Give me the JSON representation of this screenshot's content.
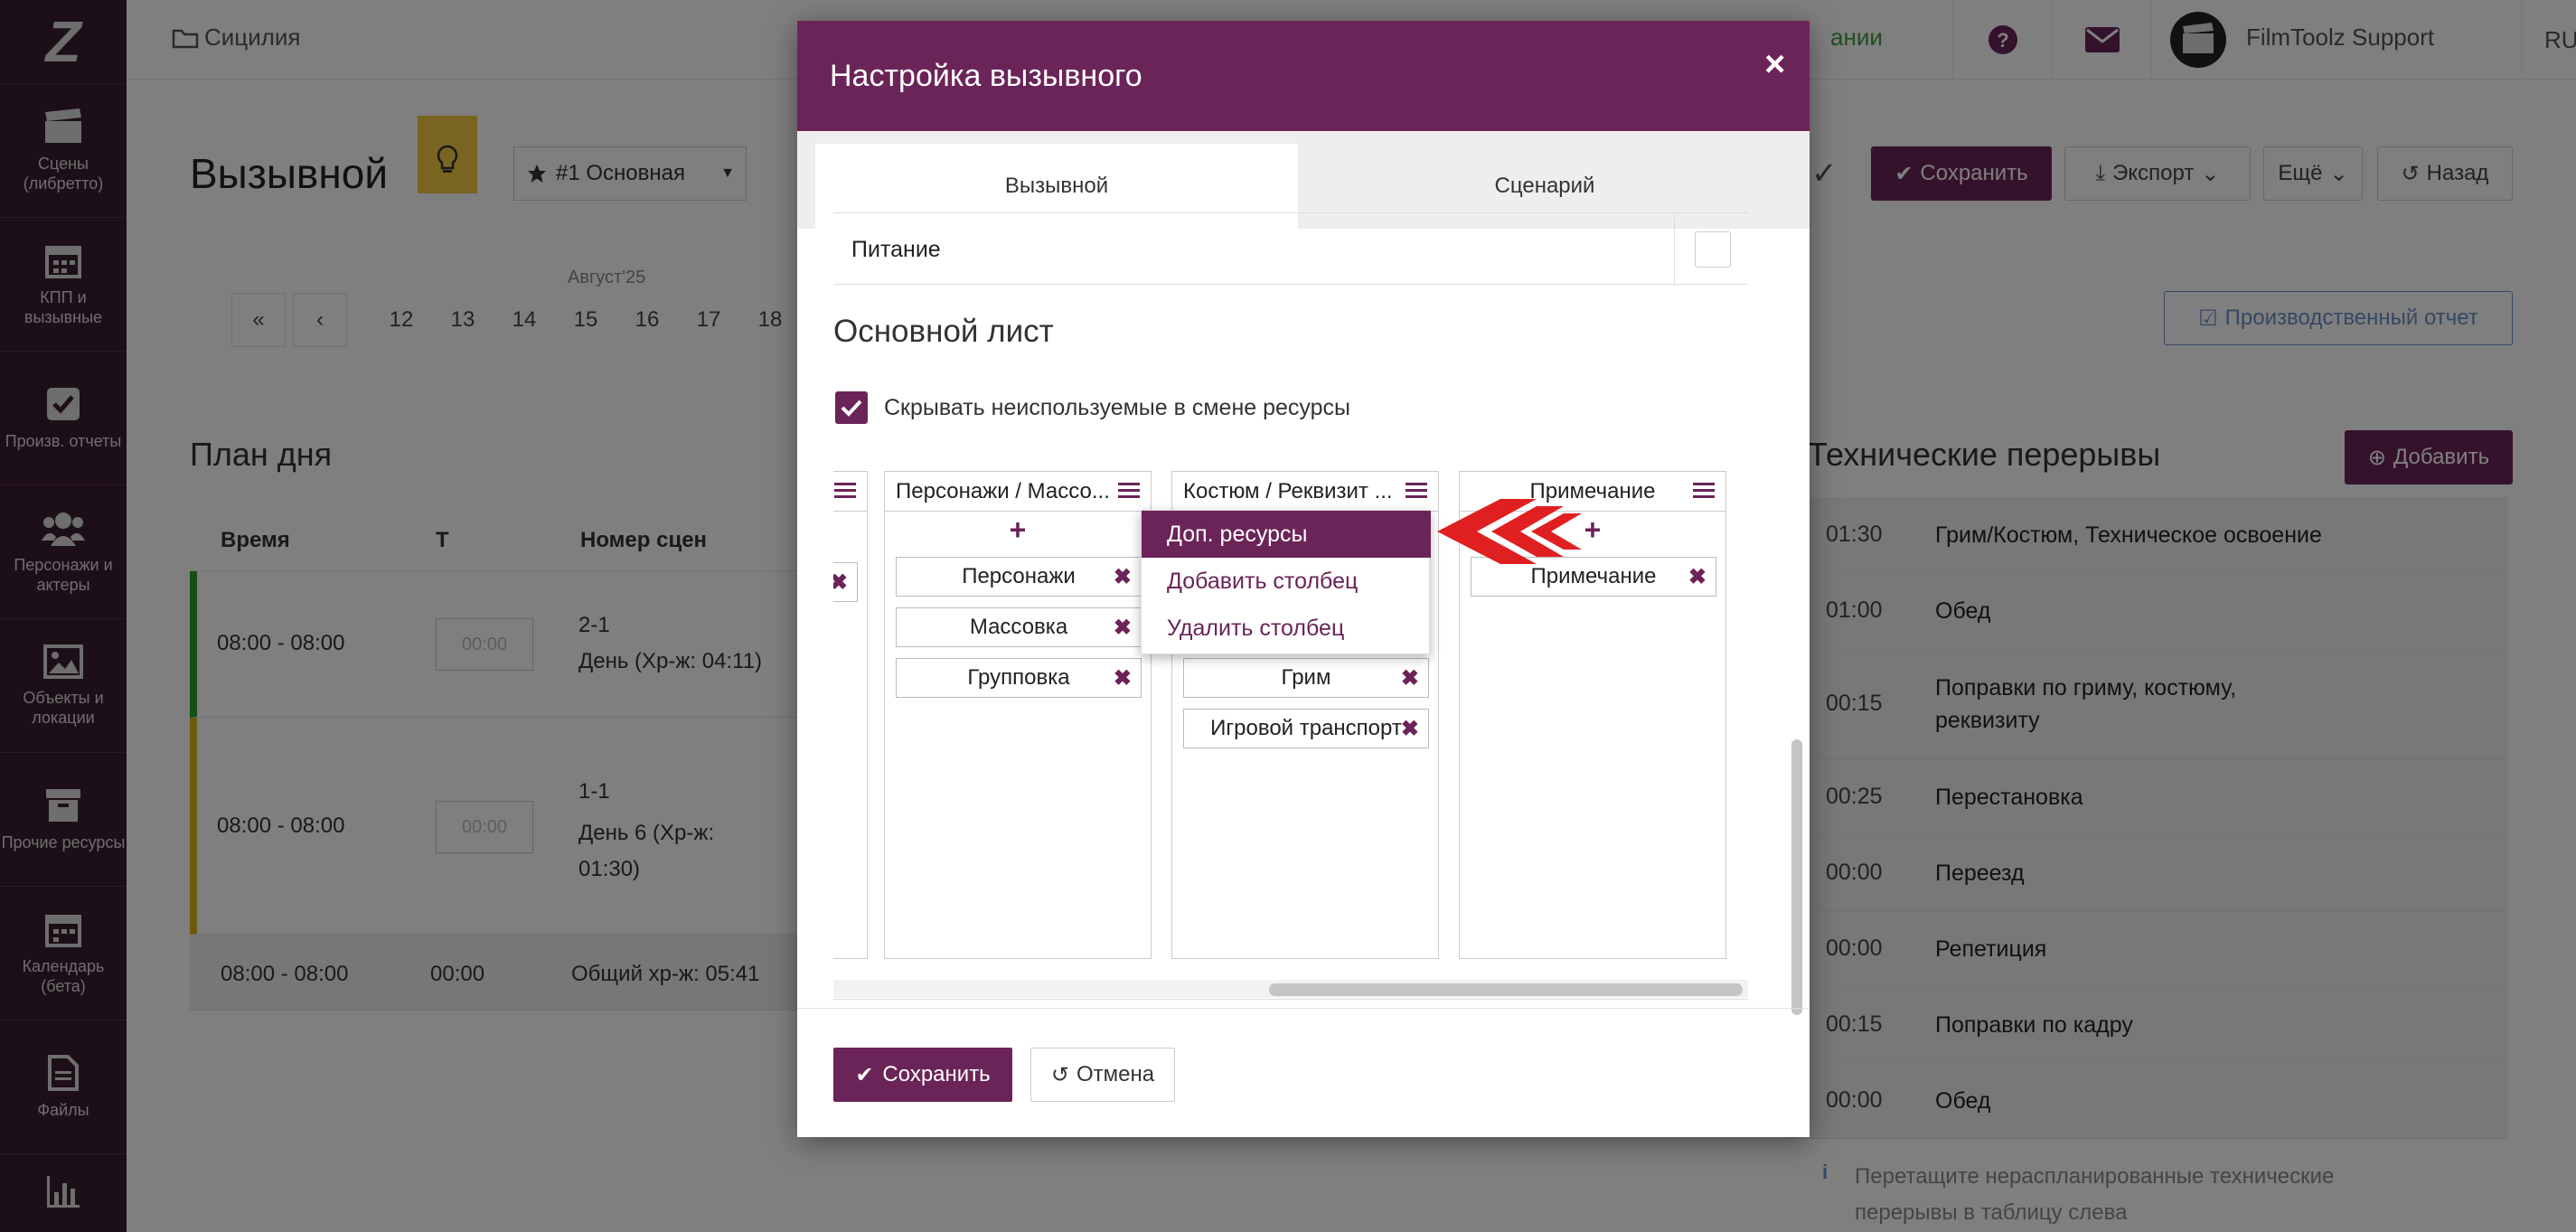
{
  "sidebar": {
    "logo": "Z",
    "items": [
      {
        "label": "Сцены (либретто)",
        "icon": "clapperboard-icon"
      },
      {
        "label": "КПП и вызывные",
        "icon": "calendar-icon"
      },
      {
        "label": "Произв. отчеты",
        "icon": "checkbox-icon"
      },
      {
        "label": "Персонажи и актеры",
        "icon": "users-icon"
      },
      {
        "label": "Объекты и локации",
        "icon": "image-icon"
      },
      {
        "label": "Прочие ресурсы",
        "icon": "archive-icon"
      },
      {
        "label": "Календарь (бета)",
        "icon": "calendar-icon"
      },
      {
        "label": "Файлы",
        "icon": "file-icon"
      }
    ]
  },
  "topbar": {
    "project": "Сицилия",
    "scheduled": "ании",
    "user": "FilmToolz Support",
    "lang": "RU"
  },
  "page": {
    "title": "Вызывной",
    "version_select": "#1 Основная",
    "month_label": "Август'25",
    "dates": [
      "12",
      "13",
      "14",
      "15",
      "16",
      "17",
      "18"
    ],
    "buttons": {
      "save": "Сохранить",
      "export": "Экспорт",
      "more": "Ещё",
      "back": "Назад",
      "production_report": "Производственный отчет"
    }
  },
  "day_plan": {
    "title": "План дня",
    "headers": [
      "Время",
      "Т",
      "Номер сцен"
    ],
    "rows": [
      {
        "time": "08:00 - 08:00",
        "placeholder": "00:00",
        "scene": "2-1",
        "desc": "День (Хр-ж: 04:11)"
      },
      {
        "time": "08:00 - 08:00",
        "placeholder": "00:00",
        "scene": "1-1",
        "desc": "День 6 (Хр-ж: 01:30)"
      }
    ],
    "total": {
      "time": "08:00 - 08:00",
      "t": "00:00",
      "desc": "Общий хр-ж: 05:41"
    }
  },
  "tech_breaks": {
    "title": "Технические перерывы",
    "add_label": "Добавить",
    "items": [
      {
        "time": "01:30",
        "name": "Грим/Костюм, Техническое освоение"
      },
      {
        "time": "01:00",
        "name": "Обед"
      },
      {
        "time": "00:15",
        "name": "Поправки по гриму, костюму, реквизиту"
      },
      {
        "time": "00:25",
        "name": "Перестановка"
      },
      {
        "time": "00:00",
        "name": "Переезд"
      },
      {
        "time": "00:00",
        "name": "Репетиция"
      },
      {
        "time": "00:15",
        "name": "Поправки по кадру"
      },
      {
        "time": "00:00",
        "name": "Обед"
      }
    ],
    "hint": "Перетащите нераспланированные технические перерывы в таблицу слева"
  },
  "modal": {
    "title": "Настройка вызывного",
    "close": "×",
    "tabs": [
      "Вызывной",
      "Сценарий"
    ],
    "food_row": "Питание",
    "section_title": "Основной лист",
    "hide_unused_label": "Скрывать неиспользуемые в смене ресурсы",
    "columns": [
      {
        "title": "Персонажи / Массо...",
        "chips": [
          "Персонажи",
          "Массовка",
          "Групповка"
        ]
      },
      {
        "title": "Костюм / Реквизит ...",
        "chips": [
          "Грим",
          "Игровой транспорт"
        ]
      },
      {
        "title": "Примечание",
        "chips": [
          "Примечание"
        ]
      }
    ],
    "dropdown": [
      "Доп. ресурсы",
      "Добавить столбец",
      "Удалить столбец"
    ],
    "save": "Сохранить",
    "cancel": "Отмена"
  },
  "colors": {
    "accent": "#6b2458",
    "green": "#3e9b3e",
    "arrow": "#e02020"
  }
}
